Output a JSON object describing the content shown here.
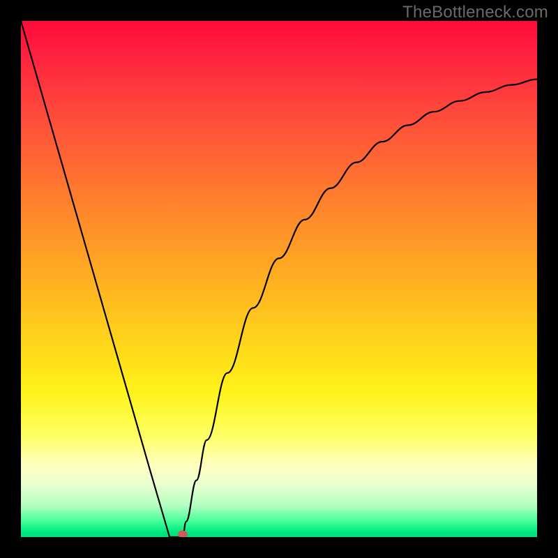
{
  "watermark": "TheBottleneck.com",
  "chart_data": {
    "type": "line",
    "title": "",
    "xlabel": "",
    "ylabel": "",
    "xlim": [
      0,
      1
    ],
    "ylim": [
      0,
      1
    ],
    "series": [
      {
        "name": "bottleneck-curve",
        "x": [
          0.0,
          0.05,
          0.1,
          0.15,
          0.2,
          0.25,
          0.288,
          0.3,
          0.313,
          0.32,
          0.34,
          0.36,
          0.4,
          0.45,
          0.5,
          0.55,
          0.6,
          0.65,
          0.7,
          0.75,
          0.8,
          0.85,
          0.9,
          0.95,
          1.0
        ],
        "y": [
          1.0,
          0.826,
          0.652,
          0.478,
          0.304,
          0.13,
          0.0,
          0.0,
          0.0,
          0.03,
          0.11,
          0.188,
          0.318,
          0.444,
          0.54,
          0.615,
          0.676,
          0.726,
          0.766,
          0.798,
          0.824,
          0.845,
          0.862,
          0.876,
          0.887
        ]
      }
    ],
    "annotations": [
      {
        "name": "min-marker",
        "x": 0.313,
        "y": 0.0,
        "color": "#cf5a57"
      }
    ],
    "background_gradient": {
      "direction": "vertical",
      "stops": [
        {
          "pos": 0.0,
          "color": "#ff0a3a"
        },
        {
          "pos": 0.33,
          "color": "#ff7a2e"
        },
        {
          "pos": 0.62,
          "color": "#ffd41a"
        },
        {
          "pos": 0.86,
          "color": "#ffffc0"
        },
        {
          "pos": 1.0,
          "color": "#00dd78"
        }
      ]
    }
  }
}
